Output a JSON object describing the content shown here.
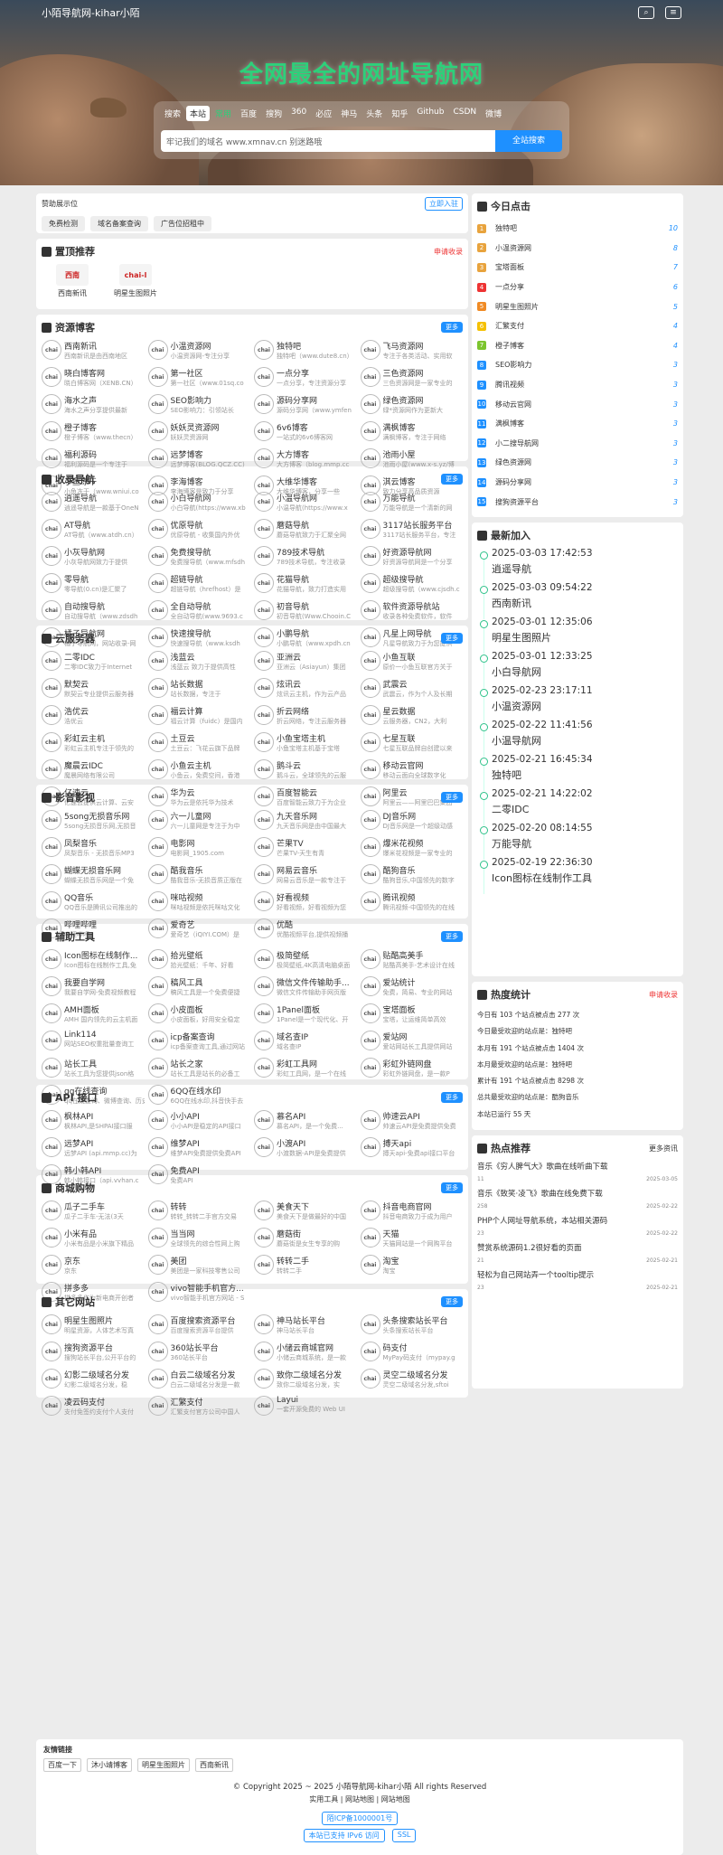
{
  "site_title": "小陌导航网-kihar小陌",
  "hero": {
    "heading": "全网最全的网址导航网",
    "tabs": [
      "搜索",
      "本站",
      "常用",
      "百度",
      "搜狗",
      "360",
      "必应",
      "神马",
      "头条",
      "知乎",
      "Github",
      "CSDN",
      "微博"
    ],
    "active_tab": "本站",
    "placeholder": "牢记我们的域名 www.xmnav.cn 别迷路哦",
    "search_button": "全站搜索"
  },
  "ad": {
    "title": "赞助展示位",
    "submit": "立即入驻",
    "buttons": [
      "免费检测",
      "域名备案查询",
      "广告位招租中"
    ]
  },
  "top": {
    "title": "置顶推荐",
    "apply": "申请收录",
    "items": [
      {
        "name": "西南新讯",
        "logo": "西南"
      },
      {
        "name": "明星生图照片",
        "logo": "chai-l"
      }
    ]
  },
  "sections": [
    {
      "title": "资源博客",
      "more": "更多",
      "items": [
        {
          "name": "西南新讯",
          "desc": "西南新讯是由西南地区"
        },
        {
          "name": "小温资源网",
          "desc": "小温资源网-专注分享"
        },
        {
          "name": "独特吧",
          "desc": "独特吧（www.dute8.cn）"
        },
        {
          "name": "飞马资源网",
          "desc": "专注于各类活动、实用软"
        },
        {
          "name": "晓白博客网",
          "desc": "晓白博客网（XENB.CN）"
        },
        {
          "name": "第一社区",
          "desc": "第一社区（www.01sq.co"
        },
        {
          "name": "一点分享",
          "desc": "一点分享，专注资源分享"
        },
        {
          "name": "三色资源网",
          "desc": "三色资源网是一家专业的"
        },
        {
          "name": "海水之声",
          "desc": "海水之声分享提供最新"
        },
        {
          "name": "SEO影响力",
          "desc": "SEO影响力：引领站长"
        },
        {
          "name": "源码分享网",
          "desc": "源码分享网（www.ymfen"
        },
        {
          "name": "绿色资源网",
          "desc": "绿*资源网作为更新大"
        },
        {
          "name": "橙子博客",
          "desc": "橙子博客（www.thecn）"
        },
        {
          "name": "妖妖灵资源网",
          "desc": "妖妖灵资源网"
        },
        {
          "name": "6v6博客",
          "desc": "一站式的6v6博客网"
        },
        {
          "name": "满枫博客",
          "desc": "满枫博客，专注于网络"
        },
        {
          "name": "福利源码",
          "desc": "福利源码是一个专注于"
        },
        {
          "name": "远梦博客",
          "desc": "远梦博客(BLOG.QCZ.CC)"
        },
        {
          "name": "大方博客",
          "desc": "大方博客（blog.mmp.cc"
        },
        {
          "name": "池雨小屋",
          "desc": "池雨小屋(www.x-s.yz/博"
        },
        {
          "name": "小鱼冻干",
          "desc": "小鱼冻干（www.wniui.co"
        },
        {
          "name": "李海博客",
          "desc": "李海博客是致力于分享"
        },
        {
          "name": "大维华博客",
          "desc": "大维华博客，分享一些"
        },
        {
          "name": "淇云博客",
          "desc": "致力分享高品质资源"
        }
      ]
    },
    {
      "title": "收录导航",
      "more": "更多",
      "items": [
        {
          "name": "逍遥导航",
          "desc": "逍遥导航是一款基于OneN"
        },
        {
          "name": "小白导航网",
          "desc": "小白导航(https://www.xb"
        },
        {
          "name": "小温导航网",
          "desc": "小温导航(https://www.x"
        },
        {
          "name": "万能导航",
          "desc": "万能导航是一个清新的网"
        },
        {
          "name": "AT导航",
          "desc": "AT导航（www.atdh.cn）"
        },
        {
          "name": "优原导航",
          "desc": "优原导航 - 收集国内外优"
        },
        {
          "name": "蘑菇导航",
          "desc": "蘑菇导航致力于汇聚全网"
        },
        {
          "name": "3117站长服务平台",
          "desc": "3117站长服务平台，专注"
        },
        {
          "name": "小灰导航网",
          "desc": "小灰导航网致力于提供"
        },
        {
          "name": "免费搜导航",
          "desc": "免费搜导航（www.mfsdh"
        },
        {
          "name": "789技术导航",
          "desc": "789技术导航，专注收录"
        },
        {
          "name": "好资源导航网",
          "desc": "好资源导航网是一个分享"
        },
        {
          "name": "零导航",
          "desc": "零导航(0.cn)是汇聚了"
        },
        {
          "name": "超链导航",
          "desc": "超链导航（hrefhost）是"
        },
        {
          "name": "花猫导航",
          "desc": "花猫导航，致力打造实用"
        },
        {
          "name": "超级搜导航",
          "desc": "超级搜导航（www.cjsdh.c"
        },
        {
          "name": "自动搜导航",
          "desc": "自动搜导航（www.zdsdh"
        },
        {
          "name": "全自动导航",
          "desc": "全自动导航(www.9693.c"
        },
        {
          "name": "初音导航",
          "desc": "初音导航(Www.Chooin.C"
        },
        {
          "name": "软件资源导航站",
          "desc": "收录各种免费软件，软件"
        },
        {
          "name": "橘子导航网",
          "desc": "橘子导航网，网站收录-网"
        },
        {
          "name": "快速搜导航",
          "desc": "快速搜导航（www.ksdh"
        },
        {
          "name": "小鹏导航",
          "desc": "小鹏导航（www.xpdh.cn"
        },
        {
          "name": "凡星上网导航",
          "desc": "凡星导航致力于为您提供"
        }
      ]
    },
    {
      "title": "云服务器",
      "more": "更多",
      "items": [
        {
          "name": "二零IDC",
          "desc": "二零IDC致力于Internet"
        },
        {
          "name": "浅蓝云",
          "desc": "浅蓝云 致力于提供高性"
        },
        {
          "name": "亚洲云",
          "desc": "亚洲云（Asiayun）集团"
        },
        {
          "name": "小鱼互联",
          "desc": "原价一小鱼互联官方关于"
        },
        {
          "name": "默契云",
          "desc": "默契云专业提供云服务器"
        },
        {
          "name": "站长数据",
          "desc": "站长数据，专注于"
        },
        {
          "name": "炫讯云",
          "desc": "炫讯云主机，作为云产品"
        },
        {
          "name": "武震云",
          "desc": "武震云，作为个人及长期"
        },
        {
          "name": "浩优云",
          "desc": "浩优云"
        },
        {
          "name": "福云计算",
          "desc": "福云计算（fuidc）是国内"
        },
        {
          "name": "折云网络",
          "desc": "折云网络，专注云服务器"
        },
        {
          "name": "星云数据",
          "desc": "云服务器，CN2，大利"
        },
        {
          "name": "彩虹云主机",
          "desc": "彩虹云主机专注于领先的"
        },
        {
          "name": "土豆云",
          "desc": "土豆云：飞花云旗下品牌"
        },
        {
          "name": "小鱼宝塔主机",
          "desc": "小鱼宝塔主机基于宝塔"
        },
        {
          "name": "七星互联",
          "desc": "七星互联品牌自创建以来"
        },
        {
          "name": "魔晨云IDC",
          "desc": "魔晨网络有限公司"
        },
        {
          "name": "小鱼云主机",
          "desc": "小鱼云，免费空间，香港"
        },
        {
          "name": "鹅斗云",
          "desc": "鹅斗云，全球领先的云服"
        },
        {
          "name": "移动云官网",
          "desc": "移动云面向全球数字化"
        },
        {
          "name": "亿速云",
          "desc": "亿速云提供云计算、云安"
        },
        {
          "name": "华为云",
          "desc": "华为云是依托华为技术"
        },
        {
          "name": "百度智能云",
          "desc": "百度智能云致力于为企业"
        },
        {
          "name": "阿里云",
          "desc": "阿里云——阿里巴巴集团"
        }
      ]
    },
    {
      "title": "影音影视",
      "more": "更多",
      "items": [
        {
          "name": "5song无损音乐网",
          "desc": "5song无损音乐网,无损音"
        },
        {
          "name": "六一儿童网",
          "desc": "六一儿童网是专注于为中"
        },
        {
          "name": "九天音乐网",
          "desc": "九天音乐网是由中国最大"
        },
        {
          "name": "DJ音乐网",
          "desc": "DJ音乐网是一个超级动感"
        },
        {
          "name": "凤梨音乐",
          "desc": "凤梨音乐 - 无损音乐MP3"
        },
        {
          "name": "电影网",
          "desc": "电影网_1905.com"
        },
        {
          "name": "芒果TV",
          "desc": "芒果TV-天生有青"
        },
        {
          "name": "爆米花视频",
          "desc": "爆米花视频是一家专业的"
        },
        {
          "name": "蝴蝶无损音乐网",
          "desc": "蝴蝶无损音乐网是一个免"
        },
        {
          "name": "酷我音乐",
          "desc": "酷我音乐-无损音质正版在"
        },
        {
          "name": "网易云音乐",
          "desc": "网易云音乐是一款专注于"
        },
        {
          "name": "酷狗音乐",
          "desc": "酷狗音乐,中国领先的数字"
        },
        {
          "name": "QQ音乐",
          "desc": "QQ音乐是腾讯公司推出的"
        },
        {
          "name": "咪咕视频",
          "desc": "咪咕视频是依托咪咕文化"
        },
        {
          "name": "好看视频",
          "desc": "好看视频，好看视频为您"
        },
        {
          "name": "腾讯视频",
          "desc": "腾讯视频-中国领先的在线"
        },
        {
          "name": "哔哩哔哩",
          "desc": "哔哩哔哩"
        },
        {
          "name": "爱奇艺",
          "desc": "爱奇艺（iQIYI.COM）是"
        },
        {
          "name": "优酷",
          "desc": "优酷视频平台,提供视频播"
        }
      ]
    },
    {
      "title": "辅助工具",
      "more": "更多",
      "items": [
        {
          "name": "Icon图标在线制作...",
          "desc": "Icon图标在线制作工具,免"
        },
        {
          "name": "拾光壁纸",
          "desc": "拾光壁纸：千年、好看"
        },
        {
          "name": "极简壁纸",
          "desc": "极简壁纸,4K高清电脑桌面"
        },
        {
          "name": "贴酷高美手",
          "desc": "贴酷高美手-艺术设计在线"
        },
        {
          "name": "我要自学网",
          "desc": "我要自学网-免费视频教程"
        },
        {
          "name": "稿风工具",
          "desc": "稿风工具是一个免费便捷"
        },
        {
          "name": "微信文件传输助手...",
          "desc": "微信文件传输助手网页版"
        },
        {
          "name": "爱站统计",
          "desc": "免费，简易、专业的网站"
        },
        {
          "name": "AMH面板",
          "desc": "AMH 国内领先的云主机面"
        },
        {
          "name": "小皮面板",
          "desc": "小皮面板，好用安全稳定"
        },
        {
          "name": "1Panel面板",
          "desc": "1Panel是一个现代化、开"
        },
        {
          "name": "宝塔面板",
          "desc": "宝塔，让运维简单高效"
        },
        {
          "name": "Link114",
          "desc": "网站SEO权重批量查询工"
        },
        {
          "name": "icp备案查询",
          "desc": "icp备案查询工具,通过网站"
        },
        {
          "name": "域名查IP",
          "desc": "域名查IP"
        },
        {
          "name": "爱站网",
          "desc": "爱站网站长工具提供网站"
        },
        {
          "name": "站长工具",
          "desc": "站长工具为您提供json格"
        },
        {
          "name": "站长之家",
          "desc": "站长工具是站长的必备工"
        },
        {
          "name": "彩虹工具网",
          "desc": "彩虹工具网，是一个在线"
        },
        {
          "name": "彩虹外链网盘",
          "desc": "彩虹外链网盘，是一款P"
        },
        {
          "name": "qq在线查询",
          "desc": "qq在线查询、微博查询、历史"
        },
        {
          "name": "6QQ在线水印",
          "desc": "6QQ在线水印,抖音快手去"
        }
      ]
    },
    {
      "title": "API 接口",
      "more": "更多",
      "items": [
        {
          "name": "枫林API",
          "desc": "枫林API,是SHPAI接口服"
        },
        {
          "name": "小小API",
          "desc": "小小API是稳定的API接口"
        },
        {
          "name": "慕名API",
          "desc": "慕名API，是一个免费..."
        },
        {
          "name": "帅速云API",
          "desc": "帅速云API是免费提供免费"
        },
        {
          "name": "远梦API",
          "desc": "远梦API (api.mmp.cc)为"
        },
        {
          "name": "维梦API",
          "desc": "维梦API免费提供免费API"
        },
        {
          "name": "小渡API",
          "desc": "小渡数据-API是免费提供"
        },
        {
          "name": "搏天api",
          "desc": "搏天api-免费api接口平台"
        },
        {
          "name": "韩小韩API",
          "desc": "韩小韩接口（api.vvhan.c"
        },
        {
          "name": "免费API",
          "desc": "免费API"
        }
      ]
    },
    {
      "title": "商城购物",
      "more": "更多",
      "items": [
        {
          "name": "瓜子二手车",
          "desc": "瓜子二手车-无法(3天"
        },
        {
          "name": "转转",
          "desc": "转转_转转二手官方交易"
        },
        {
          "name": "美食天下",
          "desc": "美食天下是做最好的中国"
        },
        {
          "name": "抖音电商官网",
          "desc": "抖音电商致力于成为用户"
        },
        {
          "name": "小米有品",
          "desc": "小米有品是小米旗下精品"
        },
        {
          "name": "当当网",
          "desc": "全球领先的综合性网上购"
        },
        {
          "name": "蘑菇街",
          "desc": "蘑菇街是女生专享的购"
        },
        {
          "name": "天猫",
          "desc": "天猫网站是一个网购平台"
        },
        {
          "name": "京东",
          "desc": "京东"
        },
        {
          "name": "美团",
          "desc": "美团是一家科技零售公司"
        },
        {
          "name": "转转二手",
          "desc": "转转二手"
        },
        {
          "name": "淘宝",
          "desc": "淘宝"
        },
        {
          "name": "拼多多",
          "desc": "拼多多作为新电商开创者"
        },
        {
          "name": "vivo智能手机官方...",
          "desc": "vivo智能手机官方网站 - S"
        }
      ]
    },
    {
      "title": "其它网站",
      "more": "更多",
      "items": [
        {
          "name": "明星生图照片",
          "desc": "明星资源，人体艺术写真"
        },
        {
          "name": "百度搜索资源平台",
          "desc": "百度搜索资源平台提供"
        },
        {
          "name": "神马站长平台",
          "desc": "神马站长平台"
        },
        {
          "name": "头条搜索站长平台",
          "desc": "头条搜索站长平台"
        },
        {
          "name": "搜狗资源平台",
          "desc": "搜狗站长平台,公开平台的"
        },
        {
          "name": "360站长平台",
          "desc": "360站长平台"
        },
        {
          "name": "小储云商城官网",
          "desc": "小储云商城系统，是一款"
        },
        {
          "name": "码支付",
          "desc": "MyPay码支付（mypay.g"
        },
        {
          "name": "幻影二级域名分发",
          "desc": "幻影二级域名分发，稳"
        },
        {
          "name": "白云二级域名分发",
          "desc": "白云二级域名分发是一款"
        },
        {
          "name": "致你二级域名分发",
          "desc": "致你二级域名分发，实"
        },
        {
          "name": "灵空二级域名分发",
          "desc": "灵空二级域名分发,sftoi"
        },
        {
          "name": "凌云码支付",
          "desc": "支付免签约支付个人支付"
        },
        {
          "name": "汇繁支付",
          "desc": "汇繁支付官方公司中国人"
        },
        {
          "name": "Layui",
          "desc": "一套开源免费的 Web UI"
        }
      ]
    }
  ],
  "today": {
    "title": "今日点击",
    "items": [
      {
        "name": "独特吧",
        "count": "10",
        "color": "#e8a33d"
      },
      {
        "name": "小温资源网",
        "count": "8",
        "color": "#e8a33d"
      },
      {
        "name": "宝塔面板",
        "count": "7",
        "color": "#e8a33d"
      },
      {
        "name": "一点分享",
        "count": "6",
        "color": "#e33"
      },
      {
        "name": "明星生图照片",
        "count": "5",
        "color": "#f08a24"
      },
      {
        "name": "汇繁支付",
        "count": "4",
        "color": "#f5c000"
      },
      {
        "name": "橙子博客",
        "count": "4",
        "color": "#7cc52e"
      },
      {
        "name": "SEO影响力",
        "count": "3",
        "color": "#1e90ff"
      },
      {
        "name": "腾讯视频",
        "count": "3",
        "color": "#1e90ff"
      },
      {
        "name": "移动云官网",
        "count": "3",
        "color": "#1e90ff"
      },
      {
        "name": "满枫博客",
        "count": "3",
        "color": "#1e90ff"
      },
      {
        "name": "小二搜导航网",
        "count": "3",
        "color": "#1e90ff"
      },
      {
        "name": "绿色资源网",
        "count": "3",
        "color": "#1e90ff"
      },
      {
        "name": "源码分享网",
        "count": "3",
        "color": "#1e90ff"
      },
      {
        "name": "搜狗资源平台",
        "count": "3",
        "color": "#1e90ff"
      }
    ]
  },
  "latest": {
    "title": "最新加入",
    "items": [
      {
        "date": "2025-03-03 17:42:53",
        "name": "逍遥导航"
      },
      {
        "date": "2025-03-03 09:54:22",
        "name": "西南新讯"
      },
      {
        "date": "2025-03-01 12:35:06",
        "name": "明星生图照片"
      },
      {
        "date": "2025-03-01 12:33:25",
        "name": "小白导航网"
      },
      {
        "date": "2025-02-23 23:17:11",
        "name": "小温资源网"
      },
      {
        "date": "2025-02-22 11:41:56",
        "name": "小温导航网"
      },
      {
        "date": "2025-02-21 16:45:34",
        "name": "独特吧"
      },
      {
        "date": "2025-02-21 14:22:02",
        "name": "二零IDC"
      },
      {
        "date": "2025-02-20 08:14:55",
        "name": "万能导航"
      },
      {
        "date": "2025-02-19 22:36:30",
        "name": "Icon图标在线制作工具"
      }
    ]
  },
  "stats": {
    "title": "热度统计",
    "apply": "申请收录",
    "lines": [
      "今日有 103 个站点被点击 277 次",
      "今日最受欢迎的站点是：独特吧",
      "本月有 191 个站点被点击 1404 次",
      "本月最受欢迎的站点是：独特吧",
      "累计有 191 个站点被点击 8298 次",
      "总共最受欢迎的站点是：酷狗音乐",
      "本站已运行 55 天"
    ]
  },
  "hot": {
    "title": "热点推荐",
    "more": "更多资讯",
    "items": [
      {
        "title": "音乐《穷人脾气大》歌曲在线听曲下载",
        "views": "11",
        "date": "2025-03-05"
      },
      {
        "title": "音乐《致笑·凌飞》歌曲在线免费下载",
        "views": "258",
        "date": "2025-02-22"
      },
      {
        "title": "PHP个人网址导航系统，本站相关源码",
        "views": "23",
        "date": "2025-02-22"
      },
      {
        "title": "赞赏系统源码1.2很好看的页面",
        "views": "21",
        "date": "2025-02-21"
      },
      {
        "title": "轻松为自己网站弄一个tooltip提示",
        "views": "23",
        "date": "2025-02-21"
      }
    ]
  },
  "footer": {
    "friend_title": "友情链接",
    "friends": [
      "百度一下",
      "沐小靖博客",
      "明星生图照片",
      "西南新讯"
    ],
    "copyright": "© Copyright 2025 ~ 2025 小陌导航网-kihar小陌 All rights Reserved",
    "links": "实用工具 | 网站地图 | 网站地图",
    "icp": "陌ICP备1000001号",
    "ipv6": "本站已支持 IPv6 访问",
    "ssl": "SSL"
  }
}
